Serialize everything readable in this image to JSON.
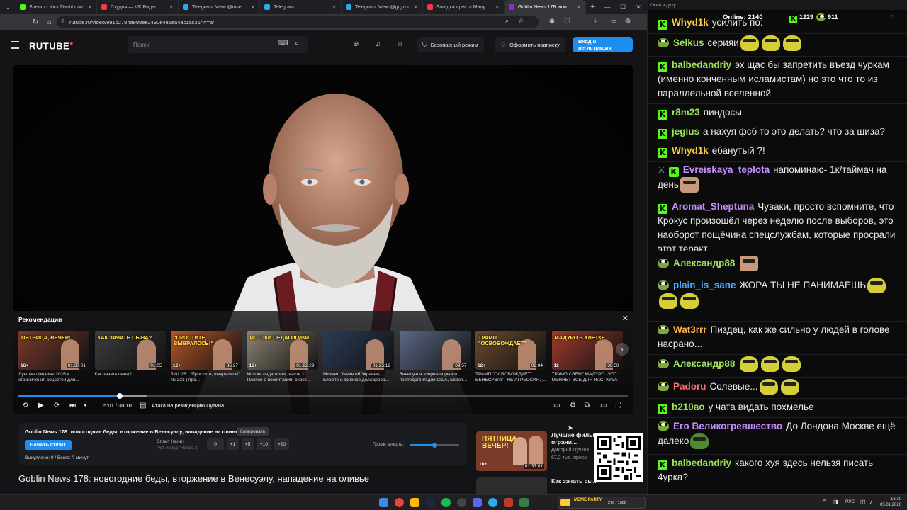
{
  "browser": {
    "tabs": [
      {
        "title": "Stream - Kick Dashboard",
        "color": "#53fc18"
      },
      {
        "title": "Студия — VK Видео Live",
        "color": "#ff3347"
      },
      {
        "title": "Telegram: View @insect_life",
        "color": "#2aabee"
      },
      {
        "title": "Telegram",
        "color": "#2aabee"
      },
      {
        "title": "Telegram: View @grgzdc",
        "color": "#2aabee"
      },
      {
        "title": "Загадка ареста Мадуро: в...",
        "color": "#ff3347"
      },
      {
        "title": "Goblin News 178: новогодн...",
        "color": "#8a2be2"
      }
    ],
    "url": "rutube.ru/video/991b2784a998ee2490e481ea4ac1ac36/?r=a/"
  },
  "rutube": {
    "logo": "RUTUBE",
    "search_placeholder": "Поиск",
    "safe_mode": "Безопасный режим",
    "subscribe": "Оформить подписку",
    "login": "Вход и регистрация"
  },
  "player": {
    "recommendations_title": "Рекомендации",
    "recommendations": [
      {
        "title": "Лучшие фильмы 2026 и ограничения соцсетей для...",
        "age": "16+",
        "duration": "01:37:01",
        "caption": "ПЯТНИЦА, ВЕЧЕР!",
        "bg": "#7a3b2a"
      },
      {
        "title": "Как зачать сына?",
        "age": "",
        "duration": "01:05",
        "caption": "КАК ЗАЧАТЬ СЫНА?",
        "bg": "#3d3d3d"
      },
      {
        "title": "3.01.26 | \"Простите, выврались!\" № 321 | про...",
        "age": "12+",
        "duration": "35:27",
        "caption": "\"ПРОСТИТЕ, ВЫВРАЛОСЬ!\"",
        "bg": "#b8572a"
      },
      {
        "title": "Истоки педагогики, часть 1: Платон о воспитании, счаст...",
        "age": "16+",
        "duration": "01:22:29",
        "caption": "ИСТОКИ ПЕДАГОГИКИ",
        "bg": "#8d8472"
      },
      {
        "title": "Михаил Хазин об Украине, Европе и кризисе долларово...",
        "age": "",
        "duration": "01:25:12",
        "caption": "",
        "bg": "#2b3c57"
      },
      {
        "title": "Венесуэла взорвала рынок: последствия для США, Европ...",
        "age": "",
        "duration": "09:57",
        "caption": "",
        "bg": "#5d6a86"
      },
      {
        "title": "ТРАМП \"ОСВОБОЖДАЕТ\" ВЕНЕСУЭЛУ | НЕ АГРЕССИЯ, ...",
        "age": "12+",
        "duration": "09:04",
        "caption": "ТРАМП \"ОСВОБОЖДАЕТ\"",
        "bg": "#6b4b2d"
      },
      {
        "title": "ТРАМП СВЕРГ МАДУРО. ЭТО МЕНЯЕТ ВСЕ ДЛЯ НАС. КУБА ...",
        "age": "12+",
        "duration": "36:50",
        "caption": "МАДУРО В КЛЕТКЕ",
        "bg": "#a13a2e"
      }
    ],
    "time_display": "05:01 / 30:10",
    "chapter": "Атака на резиденцию Путина",
    "progress": 0.166,
    "buffered": 0.21
  },
  "split": {
    "title": "Goblin News 178: новогодние беды, вторжение в Венесуэлу, нападение на оливье",
    "copy": "Копировать",
    "start": "НАЧАТЬ СПЛИТ",
    "label": "Сплит (мин):",
    "sublabel": "(уст. перед \"Начать\")",
    "buttons": [
      "0",
      "+1",
      "+5",
      "+10",
      "+20"
    ],
    "stats": "Выкуплено: 0 / Всего: ? минут",
    "volume_label": "Громк. алерта:",
    "volume": 0.5
  },
  "video_title": "Goblin News 178: новогодние беды, вторжение в Венесуэлу, нападение на оливье",
  "side": [
    {
      "title": "Лучшие фильмы 2026 и ограни...",
      "author": "Дмитрий Пучков",
      "meta": "67,2 тыс. просм",
      "duration": "01:37:01",
      "age": "16+"
    },
    {
      "title": "Как зачать сы...",
      "author": "",
      "meta": "",
      "duration": "",
      "age": ""
    }
  ],
  "chat": {
    "window_title": "Окно в духу",
    "online_label": "Online:",
    "online": "2140",
    "kick_count": "1229",
    "vk_count": "911",
    "messages": [
      {
        "platform": "kick",
        "user": "Whyd1k",
        "color": "#f7c948",
        "text": "усилить по:",
        "emotes": 0
      },
      {
        "platform": "vk",
        "user": "Selkus",
        "color": "#9be35b",
        "text": "серияи",
        "emotes": 3
      },
      {
        "platform": "kick",
        "user": "balbedandriy",
        "color": "#9be35b",
        "text": "эх щас бы запретить въезд чуркам (именно конченным исламистам) но это что то из параллельной вселенной",
        "emotes": 0
      },
      {
        "platform": "kick",
        "user": "r8m23",
        "color": "#9be35b",
        "text": "пиндосы",
        "emotes": 0
      },
      {
        "platform": "kick",
        "user": "jegius",
        "color": "#9be35b",
        "text": "а нахуя фсб то это делать? что за шиза?",
        "emotes": 0
      },
      {
        "platform": "kick",
        "user": "Whyd1k",
        "color": "#f7c948",
        "text": "ебанутый ?!",
        "emotes": 0
      },
      {
        "platform": "kick",
        "user": "Evreiskaya_teplota",
        "color": "#c58cff",
        "text": "напоминаю- 1к/таймач на день",
        "emotes": 1,
        "mod": true
      },
      {
        "platform": "kick",
        "user": "Aromat_Sheptuna",
        "color": "#c58cff",
        "text": "Чуваки, просто вспомните, что Крокус произошёл через неделю после выборов, это наоборот пощёчина спецслужбам, которые просрали этот теракт",
        "emotes": 0
      },
      {
        "platform": "vk",
        "user": "Александр88",
        "color": "#9be35b",
        "text": "",
        "emotes": 1
      },
      {
        "platform": "vk",
        "user": "plain_is_sane",
        "color": "#4aa6ff",
        "text": "ЖОРА ТЫ НЕ ПАНИМАЕШЬ",
        "emotes": 3
      },
      {
        "platform": "vk",
        "user": "Wat3rrr",
        "color": "#ffb347",
        "text": "Пиздец, как же сильно у людей в голове насрано...",
        "emotes": 0
      },
      {
        "platform": "vk",
        "user": "Александр88",
        "color": "#9be35b",
        "text": "",
        "emotes": 3
      },
      {
        "platform": "vk",
        "user": "Padoru",
        "color": "#ff6b6b",
        "text": "Солевые...",
        "emotes": 2
      },
      {
        "platform": "kick",
        "user": "b210ao",
        "color": "#9be35b",
        "text": "у чата видать похмелье",
        "emotes": 0
      },
      {
        "platform": "vk",
        "user": "Его Великогревшество",
        "color": "#c58cff",
        "text": "До Лондона Москве ещё далеко",
        "emotes": 1
      },
      {
        "platform": "kick",
        "user": "balbedandriy",
        "color": "#9be35b",
        "text": "какого хуя здесь нельзя писать 4урка?",
        "emotes": 0
      }
    ]
  },
  "taskbar": {
    "widget_name": "MEME PARTY",
    "widget_count": "276 / 1500",
    "lang": "РУС",
    "time": "16:30",
    "date": "05.01.2026"
  }
}
